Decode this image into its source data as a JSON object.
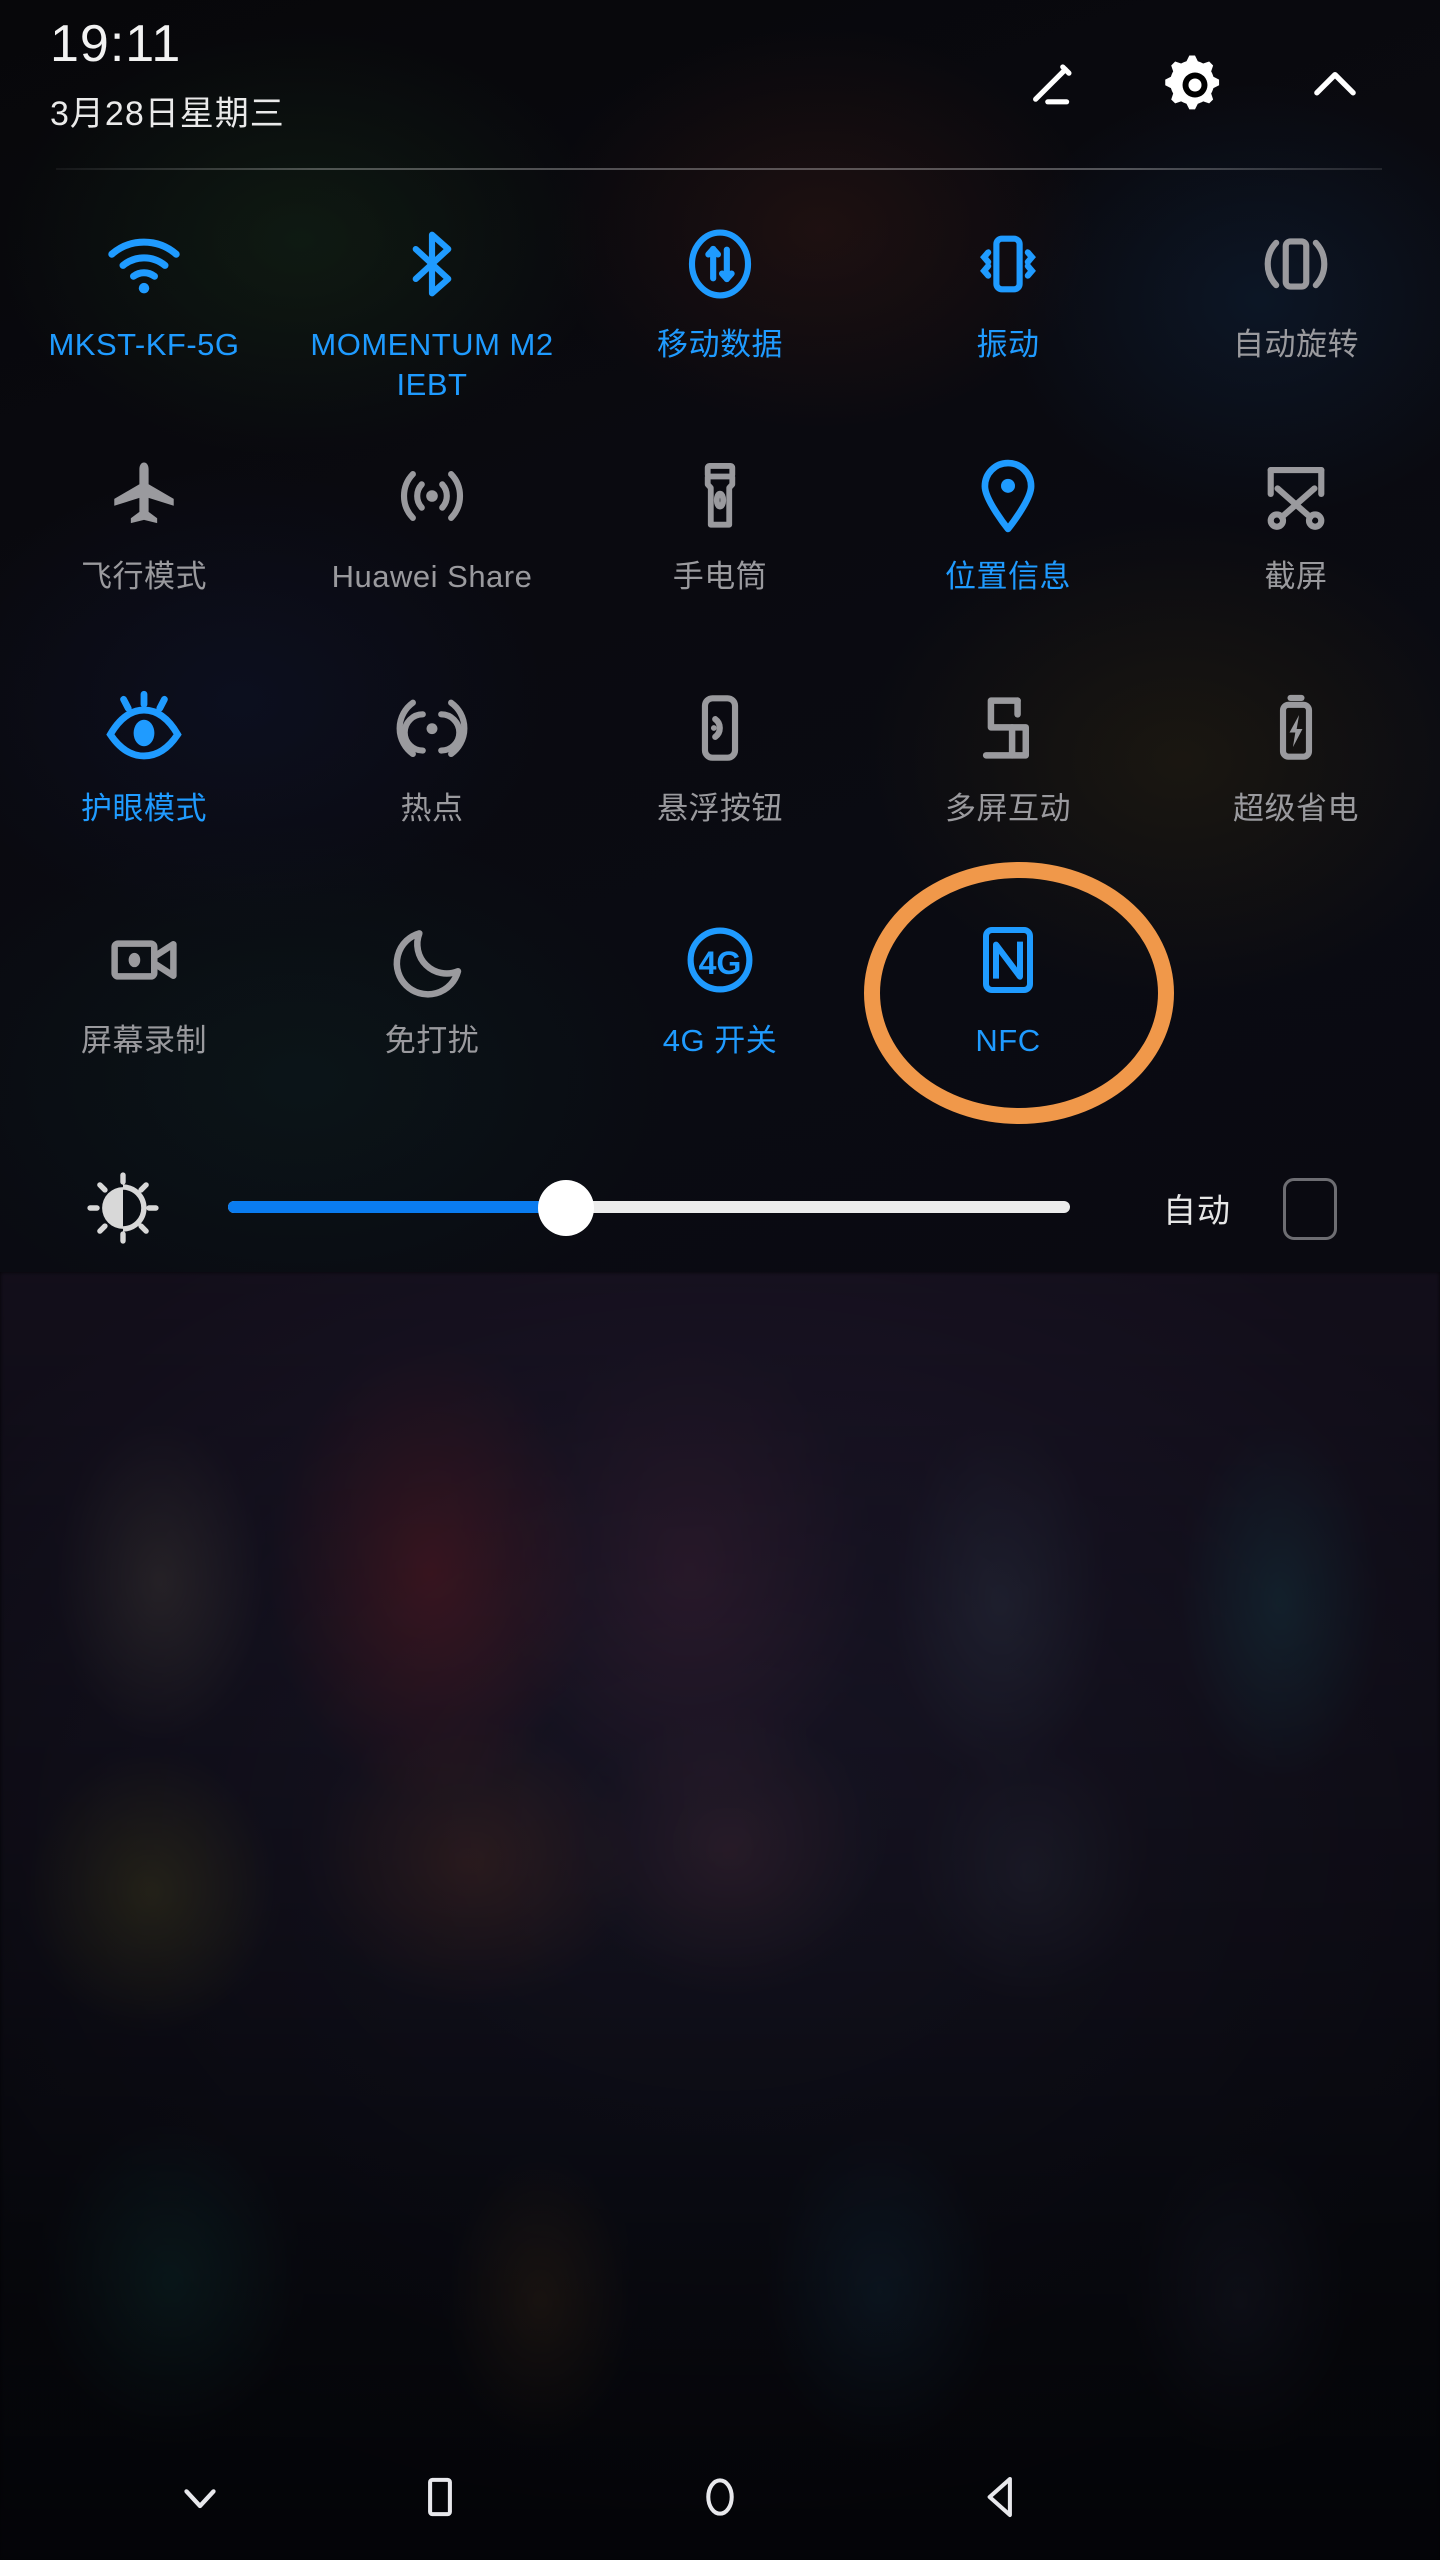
{
  "status_bar": {
    "time": "19:11",
    "date": "3月28日星期三",
    "icons": [
      {
        "name": "edit-icon",
        "label": "编辑"
      },
      {
        "name": "settings-gear-icon",
        "label": "设置"
      },
      {
        "name": "chevron-up-icon",
        "label": "收起"
      }
    ]
  },
  "quick_settings": {
    "tiles": [
      {
        "id": "wifi",
        "icon": "wifi-icon",
        "label": "MKST-KF-5G",
        "state": "on"
      },
      {
        "id": "bluetooth",
        "icon": "bluetooth-icon",
        "label": "MOMENTUM M2 IEBT",
        "state": "on"
      },
      {
        "id": "mobile-data",
        "icon": "mobile-data-icon",
        "label": "移动数据",
        "state": "on"
      },
      {
        "id": "vibrate",
        "icon": "vibrate-icon",
        "label": "振动",
        "state": "on"
      },
      {
        "id": "auto-rotate",
        "icon": "auto-rotate-icon",
        "label": "自动旋转",
        "state": "off"
      },
      {
        "id": "airplane-mode",
        "icon": "airplane-icon",
        "label": "飞行模式",
        "state": "off"
      },
      {
        "id": "huawei-share",
        "icon": "huawei-share-icon",
        "label": "Huawei Share",
        "state": "off"
      },
      {
        "id": "flashlight",
        "icon": "flashlight-icon",
        "label": "手电筒",
        "state": "off"
      },
      {
        "id": "location",
        "icon": "location-pin-icon",
        "label": "位置信息",
        "state": "on"
      },
      {
        "id": "screenshot",
        "icon": "scissors-icon",
        "label": "截屏",
        "state": "off"
      },
      {
        "id": "eye-comfort",
        "icon": "eye-icon",
        "label": "护眼模式",
        "state": "on"
      },
      {
        "id": "hotspot",
        "icon": "hotspot-icon",
        "label": "热点",
        "state": "off"
      },
      {
        "id": "floating-button",
        "icon": "floating-button-icon",
        "label": "悬浮按钮",
        "state": "off"
      },
      {
        "id": "multi-screen",
        "icon": "multi-screen-icon",
        "label": "多屏互动",
        "state": "off"
      },
      {
        "id": "ultra-power",
        "icon": "battery-bolt-icon",
        "label": "超级省电",
        "state": "off"
      },
      {
        "id": "screen-record",
        "icon": "video-camera-icon",
        "label": "屏幕录制",
        "state": "off"
      },
      {
        "id": "do-not-disturb",
        "icon": "moon-icon",
        "label": "免打扰",
        "state": "off"
      },
      {
        "id": "4g-switch",
        "icon": "4g-icon",
        "label": "4G 开关",
        "state": "on"
      },
      {
        "id": "nfc",
        "icon": "nfc-icon",
        "label": "NFC",
        "state": "on"
      }
    ]
  },
  "annotation": {
    "target": "nfc",
    "shape": "ellipse",
    "color": "#f0984a"
  },
  "brightness": {
    "icon": "brightness-icon",
    "value_percent": 40,
    "auto_label": "自动",
    "auto_checked": false
  },
  "navigation_bar": {
    "buttons": [
      {
        "name": "collapse-panel-button",
        "icon": "chevron-down-icon"
      },
      {
        "name": "recents-button",
        "icon": "square-icon"
      },
      {
        "name": "home-button",
        "icon": "circle-icon"
      },
      {
        "name": "back-button",
        "icon": "triangle-left-icon"
      }
    ]
  },
  "colors": {
    "accent_on": "#1f9bff",
    "inactive": "#9a9a9e",
    "annotation": "#f0984a",
    "slider_fill": "#0a7cf0",
    "slider_track": "#ececec"
  }
}
